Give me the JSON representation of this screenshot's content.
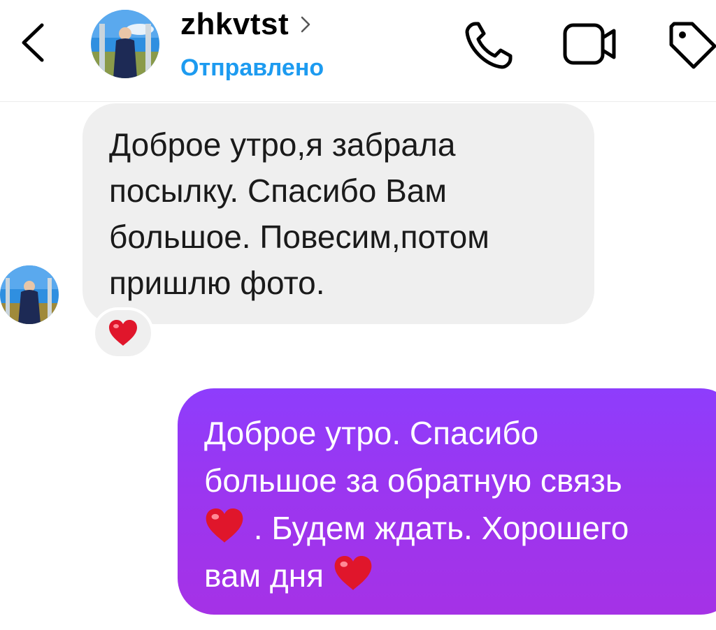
{
  "header": {
    "username": "zhkvtst",
    "status": "Отправлено",
    "icons": {
      "back": "back-chevron-icon",
      "chevron": "chevron-right-icon",
      "call": "phone-icon",
      "video": "video-camera-icon",
      "tag": "tag-icon"
    }
  },
  "messages": [
    {
      "direction": "incoming",
      "text": "Доброе утро,я забрала посылку. Спасибо Вам большое. Повесим,потом пришлю фото.",
      "lines": [
        "Доброе утро,я забрала",
        "посылку. Спасибо Вам",
        "большое. Повесим,потом",
        "пришлю фото."
      ],
      "reaction": "heart-icon"
    },
    {
      "direction": "outgoing",
      "lines": [
        "Доброе утро. Спасибо",
        "большое за обратную связь",
        ". Будем ждать. Хорошего",
        "вам дня"
      ]
    }
  ],
  "colors": {
    "accent_blue": "#1d9bf0",
    "incoming_bubble": "#efefef",
    "outgoing_bubble": "#9b36f0",
    "heart": "#e0162b"
  }
}
